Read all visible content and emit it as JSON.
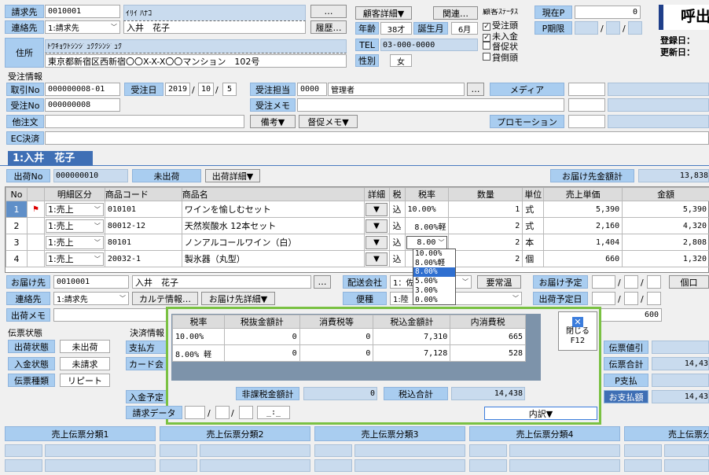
{
  "header": {
    "seikyusaki_label": "請求先",
    "seikyusaki_code": "0010001",
    "name_kana": "ｲﾘｲ ﾊﾅｺ",
    "dots": "…",
    "kokyaku_shosai": "顧客詳細▼",
    "kanren": "関連…",
    "kokyaku_status": "顧客ｽﾃｰﾀｽ",
    "genzai_p": "現在P",
    "genzai_p_val": "0",
    "renrakusaki_label": "連絡先",
    "renrakusaki_val": "1:請求先",
    "name": "入井　花子",
    "rireki": "履歴…",
    "nenrei_label": "年齢",
    "nenrei_val": "38才",
    "tanjoubi_label": "誕生月",
    "tanjoubi_val": "6月",
    "p_kigen": "P期限",
    "date_sep": "/",
    "jusho_label": "住所",
    "address_kana": "ﾄｳｷｮｳﾄｼﾝｼﾞｭｸｸｼﾝｼﾞｭｸ",
    "address": "東京都新宿区西新宿〇〇X-X-X〇〇マンション　102号",
    "tel_label": "TEL",
    "tel_val": "03-000-0000",
    "seibetsu_label": "性別",
    "seibetsu_val": "女",
    "status_items": [
      {
        "label": "受注頭",
        "checked": true
      },
      {
        "label": "未入金",
        "checked": true
      },
      {
        "label": "督促状",
        "checked": false
      },
      {
        "label": "貸倒頭",
        "checked": false
      }
    ],
    "yobidashi": "呼出",
    "toroku": "登録日：",
    "koshin": "更新日："
  },
  "order": {
    "section_label": "受注情報",
    "torihiki_label": "取引No",
    "torihiki_val": "000000008-01",
    "juchu_date_label": "受注日",
    "year": "2019",
    "month": "10",
    "day": "5",
    "tanto_label": "受注担当",
    "tanto_code": "0000",
    "tanto_name": "管理者",
    "media_label": "メディア",
    "juchu_no_label": "受注No",
    "juchu_no_val": "000000008",
    "memo_label": "受注メモ",
    "tachumon_label": "他注文",
    "biko": "備考▼",
    "tokusoku": "督促メモ▼",
    "promotion": "プロモーション",
    "ec_label": "EC決済"
  },
  "tab": {
    "label": "1:入井　花子"
  },
  "shipping": {
    "shukka_no_label": "出荷No",
    "shukka_no_val": "000000010",
    "status": "未出荷",
    "shukka_shosai": "出荷詳細▼",
    "otodoke_gokei_label": "お届け先金額計",
    "otodoke_gokei_val": "13,838"
  },
  "table": {
    "headers": [
      "No",
      "",
      "明細区分",
      "商品コード",
      "商品名",
      "詳細",
      "税",
      "税率",
      "数量",
      "単位",
      "売上単価",
      "金額"
    ],
    "rows": [
      {
        "no": "1",
        "kubun": "1:売上",
        "code": "010101",
        "name": "ワインを愉しむセット",
        "detail": "▼",
        "tax": "込",
        "rate": "10.00%",
        "qty": "1",
        "unit": "式",
        "price": "5,390",
        "amount": "5,390"
      },
      {
        "no": "2",
        "kubun": "1:売上",
        "code": "80012-12",
        "name": "天然炭酸水 12本セット",
        "detail": "▼",
        "tax": "込",
        "rate": "8.00%軽",
        "qty": "2",
        "unit": "式",
        "price": "2,160",
        "amount": "4,320"
      },
      {
        "no": "3",
        "kubun": "1:売上",
        "code": "80101",
        "name": "ノンアルコールワイン（白）",
        "detail": "▼",
        "tax": "込",
        "rate": "8.00",
        "qty": "2",
        "unit": "本",
        "price": "1,404",
        "amount": "2,808"
      },
      {
        "no": "4",
        "kubun": "1:売上",
        "code": "20032-1",
        "name": "製氷器（丸型）",
        "detail": "▼",
        "tax": "込",
        "rate": "",
        "qty": "2",
        "unit": "個",
        "price": "660",
        "amount": "1,320"
      }
    ],
    "rate_options": [
      "10.00%",
      "8.00%軽",
      "8.00%",
      "5.00%",
      "3.00%",
      "0.00%"
    ]
  },
  "delivery": {
    "otodoke_label": "お届け先",
    "otodoke_code": "0010001",
    "otodoke_name": "入井　花子",
    "haisou_label": "配送会社",
    "haisou_val": "1：佐",
    "yojoon": "要常温",
    "yotei_label": "お届け予定",
    "ikko": "個口",
    "renraku_label": "連絡先",
    "renraku_val": "1:請求先",
    "karute": "カルテ情報…",
    "otodoke_shosai": "お届け先詳細▼",
    "bin_label": "便種",
    "bin_val": "1:陸",
    "shukka_yotei": "出荷予定日",
    "memo_label": "出荷メモ",
    "memo_right": "600"
  },
  "bottom": {
    "denpyo_label": "伝票状態",
    "shukka_jotai": "出荷状態",
    "mishukka": "未出荷",
    "nyukin_jotai": "入金状態",
    "miseikyu": "未請求",
    "denpyo_shubetsu": "伝票種類",
    "repeat": "リピート",
    "kessai_label": "決済情報",
    "shiharai": "支払方",
    "card": "カード会",
    "nyukin_yotei": "入金予定",
    "seikyu_data": "請求データ",
    "seikyu_time": "_:_",
    "denpyo_nebiki": "伝票値引",
    "denpyo_gokei": "伝票合計",
    "denpyo_gokei_val": "14,43",
    "p_shiharai": "P支払",
    "oshiharai": "お支払額",
    "oshiharai_val": "14,43",
    "bunrui": [
      "売上伝票分類1",
      "売上伝票分類2",
      "売上伝票分類3",
      "売上伝票分類4",
      "売上伝票分"
    ]
  },
  "popup": {
    "headers": [
      "税率",
      "税抜金額計",
      "消費税等",
      "税込金額計",
      "内消費税"
    ],
    "rows": [
      [
        "10.00%",
        "0",
        "0",
        "7,310",
        "665"
      ],
      [
        "8.00% 軽",
        "0",
        "0",
        "7,128",
        "528"
      ]
    ],
    "hikazei_label": "非課税金額計",
    "hikazei_val": "0",
    "zeikomi_label": "税込合計",
    "zeikomi_val": "14,438",
    "close_label": "閉じる",
    "close_key": "F12",
    "uchiwake": "内訳▼"
  }
}
